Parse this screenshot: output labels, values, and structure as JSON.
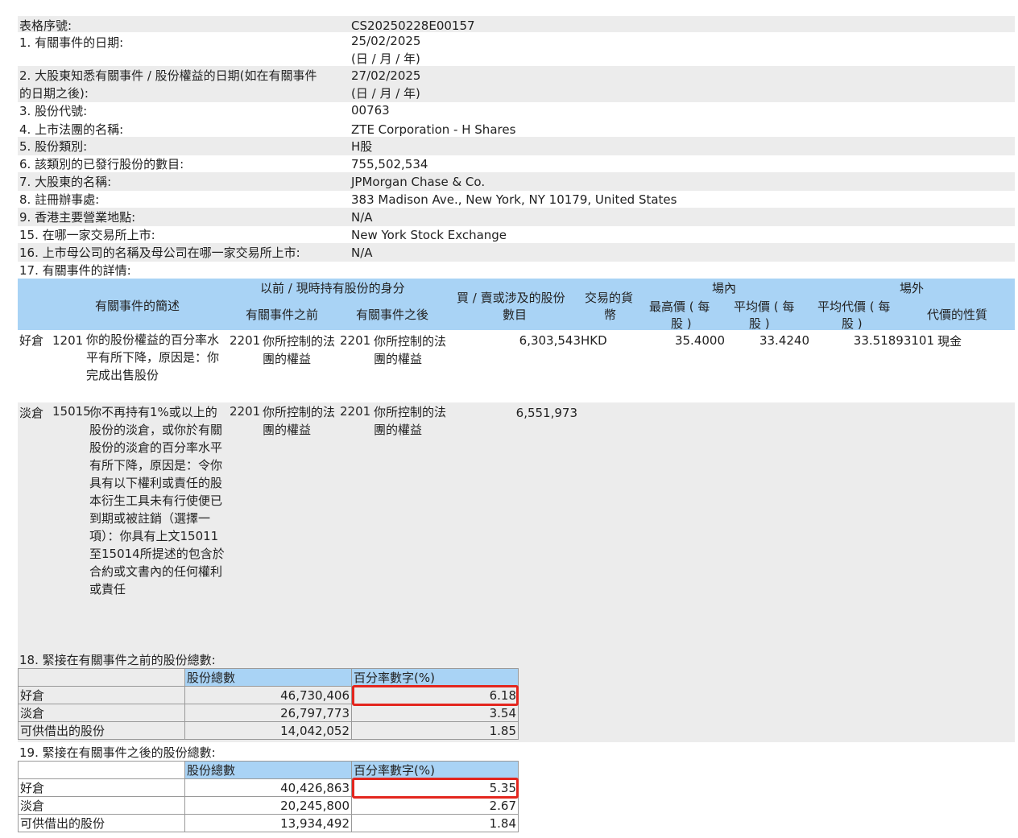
{
  "rows": [
    {
      "label": "表格序號:",
      "value": "CS20250228E00157"
    },
    {
      "label": "1. 有關事件的日期:",
      "value": "25/02/2025",
      "value2": "(日 / 月 / 年)"
    },
    {
      "label": "2. 大股東知悉有關事件 / 股份權益的日期(如在有關事件",
      "label2": "的日期之後):",
      "value": "27/02/2025",
      "value2": "(日 / 月 / 年)"
    },
    {
      "label": "3. 股份代號:",
      "value": "00763"
    },
    {
      "label": "4. 上市法團的名稱:",
      "value": "ZTE Corporation - H Shares"
    },
    {
      "label": "5. 股份類別:",
      "value": "H股"
    },
    {
      "label": "6. 該類別的已發行股份的數目:",
      "value": "755,502,534"
    },
    {
      "label": "7. 大股東的名稱:",
      "value": "JPMorgan Chase & Co."
    },
    {
      "label": "8. 註冊辦事處:",
      "value": "383 Madison Ave., New York, NY 10179, United States"
    },
    {
      "label": "9. 香港主要營業地點:",
      "value": "N/A"
    },
    {
      "label": "15. 在哪一家交易所上市:",
      "value": "New York Stock Exchange"
    },
    {
      "label": "16. 上市母公司的名稱及母公司在哪一家交易所上市:",
      "value": "N/A"
    },
    {
      "label": "17. 有關事件的詳情:"
    }
  ],
  "event_table": {
    "headers": {
      "description": "有關事件的簡述",
      "capacity_group": "以前 / 現時持有股份的身分",
      "capacity_before": "有關事件之前",
      "capacity_after": "有關事件之後",
      "shares_l1": "買 / 賣或涉及的股份",
      "shares_l2": "數目",
      "currency_l1": "交易的貨",
      "currency_l2": "幣",
      "on_exchange": "場內",
      "high_l1": "最高價 ( 每",
      "high_l2": "股 )",
      "avg_l1": "平均價 ( 每",
      "avg_l2": "股 )",
      "off_exchange": "場外",
      "offavg_l1": "平均代價 ( 每",
      "offavg_l2": "股 )",
      "consideration": "代價的性質"
    },
    "rows": [
      {
        "position": "好倉",
        "code": "1201",
        "desc": "你的股份權益的百分率水平有所下降，原因是：你完成出售股份",
        "before_code": "2201",
        "before_text": "你所控制的法團的權益",
        "after_code": "2201",
        "after_text": "你所控制的法團的權益",
        "shares": "6,303,543",
        "currency": "HKD",
        "high": "35.4000",
        "avg": "33.4240",
        "off_avg": "33.51893101",
        "nature": "現金"
      },
      {
        "position": "淡倉",
        "code": "15015",
        "desc": "你不再持有1%或以上的股份的淡倉，或你於有關股份的淡倉的百分率水平有所下降，原因是：令你具有以下權利或責任的股本衍生工具未有行使便已到期或被註銷（選擇一項）：你具有上文15011至15014所提述的包含於合約或文書內的任何權利或責任",
        "before_code": "2201",
        "before_text": "你所控制的法團的權益",
        "after_code": "2201",
        "after_text": "你所控制的法團的權益",
        "shares": "6,551,973",
        "currency": "",
        "high": "",
        "avg": "",
        "off_avg": "",
        "nature": ""
      }
    ]
  },
  "section18": {
    "title": "18. 緊接在有關事件之前的股份總數:",
    "col_shares": "股份總數",
    "col_pct": "百分率數字(%)",
    "rows": [
      {
        "label": "好倉",
        "shares": "46,730,406",
        "pct": "6.18"
      },
      {
        "label": "淡倉",
        "shares": "26,797,773",
        "pct": "3.54"
      },
      {
        "label": "可供借出的股份",
        "shares": "14,042,052",
        "pct": "1.85"
      }
    ]
  },
  "section19": {
    "title": "19. 緊接在有關事件之後的股份總數:",
    "col_shares": "股份總數",
    "col_pct": "百分率數字(%)",
    "rows": [
      {
        "label": "好倉",
        "shares": "40,426,863",
        "pct": "5.35"
      },
      {
        "label": "淡倉",
        "shares": "20,245,800",
        "pct": "2.67"
      },
      {
        "label": "可供借出的股份",
        "shares": "13,934,492",
        "pct": "1.84"
      }
    ]
  },
  "colors": {
    "header_blue": "#a9d3f5",
    "band_gray": "#ececec",
    "highlight_red": "#e3261e"
  }
}
